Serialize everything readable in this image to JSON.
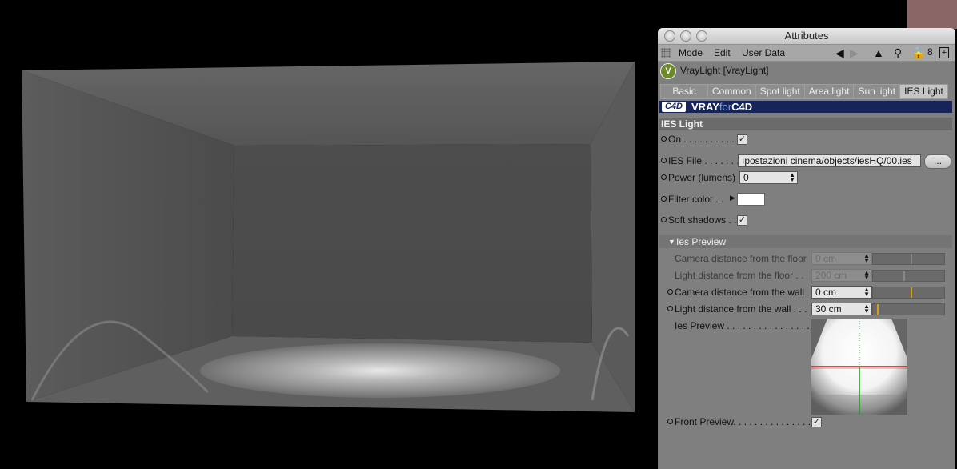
{
  "panel": {
    "title": "Attributes",
    "menu": [
      "Mode",
      "Edit",
      "User Data"
    ],
    "object_name": "VrayLight [VrayLight]",
    "tabs": [
      "Basic",
      "Common",
      "Spot light",
      "Area light",
      "Sun light",
      "IES Light"
    ],
    "active_tab": "IES Light",
    "banner": {
      "badge": "C4D",
      "vray": "VRAY",
      "for": "for",
      "c4d": "C4D"
    },
    "section_title": "IES Light",
    "fields": {
      "on_label": "On . . . . . . . . . . .",
      "ies_file_label": "IES File . . . . . . .",
      "ies_file_value": "ıpostazioni cinema/objects/iesHQ/00.ies",
      "browse_label": "...",
      "power_label": "Power (lumens)",
      "power_value": "0",
      "filter_color_label": "Filter color . .",
      "soft_shadows_label": "Soft shadows . ."
    },
    "preview_section": "Ies Preview",
    "preview_rows": [
      {
        "label": "Camera distance from the floor",
        "value": "0 cm",
        "enabled": false
      },
      {
        "label": "Light distance from the floor . .",
        "value": "200 cm",
        "enabled": false
      },
      {
        "label": "Camera distance from the wall",
        "value": "0 cm",
        "enabled": true
      },
      {
        "label": "Light distance from the wall . . .",
        "value": "30 cm",
        "enabled": true
      }
    ],
    "ies_preview_label": "Ies Preview . . . . . . . . . . . . . . . . .",
    "front_preview_label": "Front Preview. . . . . . . . . . . . . . . .",
    "checks": {
      "on": true,
      "soft_shadows": true,
      "front_preview": true
    },
    "colors": {
      "accent_marker": "#e39a13",
      "banner": "#16245a",
      "filter_color": "#ffffff"
    }
  }
}
